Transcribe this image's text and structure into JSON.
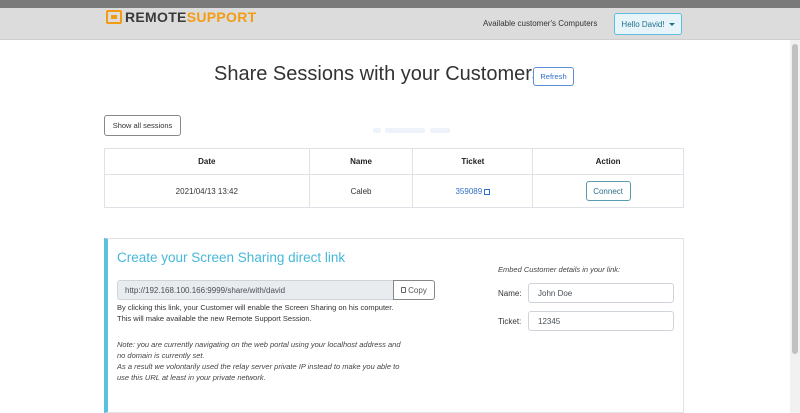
{
  "navbar": {
    "logo_mark": "TS",
    "logo_part1": "REMOTE",
    "logo_part2": "SUPPORT",
    "available_link": "Available customer's Computers",
    "user_menu": "Hello David!"
  },
  "colors": {
    "accent_orange": "#f39c12",
    "info_blue": "#5bc0de",
    "link_blue": "#2f6fc6"
  },
  "page": {
    "title": "Share Sessions with your Customers",
    "refresh_label": "Refresh",
    "show_all_label": "Show all sessions"
  },
  "sessions_table": {
    "headers": [
      "Date",
      "Name",
      "Ticket",
      "Action"
    ],
    "rows": [
      {
        "date": "2021/04/13 13:42",
        "name": "Caleb",
        "ticket": "359089",
        "action": "Connect"
      }
    ]
  },
  "direct_link": {
    "title": "Create your Screen Sharing direct link",
    "url": "http://192.168.100.166:9999/share/with/david",
    "copy_label": "Copy",
    "desc_line1": "By clicking this link, your Customer will enable the Screen Sharing on his computer.",
    "desc_line2": "This will make available the new Remote Support Session.",
    "note_line1": "Note: you are currently navigating on the web portal using your localhost address and",
    "note_line2": "no domain is currently set.",
    "note_line3": "As a result we volontarily used the relay server private IP instead to make you able to",
    "note_line4": "use this URL at least in your private network."
  },
  "embed": {
    "title": "Embed Customer details in your link:",
    "name_label": "Name:",
    "name_placeholder": "John Doe",
    "ticket_label": "Ticket:",
    "ticket_placeholder": "12345"
  },
  "icons": [
    "external-link-icon",
    "copy-icon",
    "chevron-down-icon"
  ]
}
